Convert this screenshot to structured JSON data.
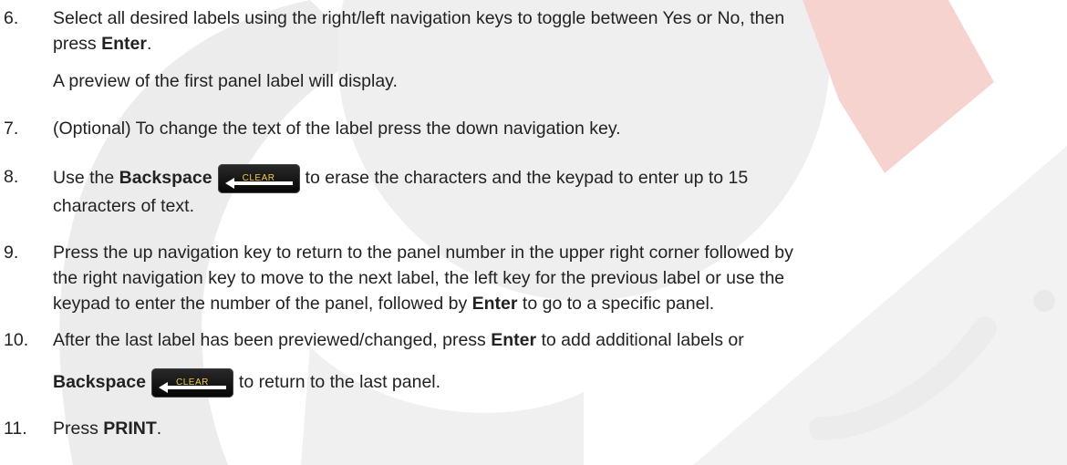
{
  "steps": [
    {
      "num": "6.",
      "line1": "Select all desired labels using the right/left navigation keys to toggle between Yes or No, then",
      "line2_pre": "press ",
      "line2_bold": "Enter",
      "line2_post": ".",
      "note": "A preview of the first panel label will display."
    },
    {
      "num": "7.",
      "text": "(Optional) To change the text of the label press the down navigation key."
    },
    {
      "num": "8.",
      "pre": "Use the ",
      "bold": "Backspace",
      "post": "to erase the characters and the keypad to enter up to 15",
      "line2": "characters of text."
    },
    {
      "num": "9.",
      "line1": "Press the up navigation key to return to the panel number in the upper right corner followed by",
      "line2": "the right navigation key to move to the next label, the left key for the previous label or use the",
      "line3_pre": "keypad to enter the number of the panel, followed by ",
      "line3_bold": "Enter",
      "line3_post": " to go to a specific panel."
    },
    {
      "num": "10.",
      "line1_pre": "After the last label has been previewed/changed, press ",
      "line1_bold": "Enter",
      "line1_post": " to add additional labels or",
      "line2_bold": "Backspace",
      "line2_post": "to return to the last panel."
    },
    {
      "num": "11.",
      "pre": "Press ",
      "bold": "PRINT",
      "post": "."
    }
  ],
  "key": {
    "label": "CLEAR",
    "icon": "left-arrow-icon",
    "label_color": "#f3c94a",
    "background": "#111111"
  },
  "watermark": {
    "gray": "#ececec",
    "red": "#f6c7c2"
  }
}
